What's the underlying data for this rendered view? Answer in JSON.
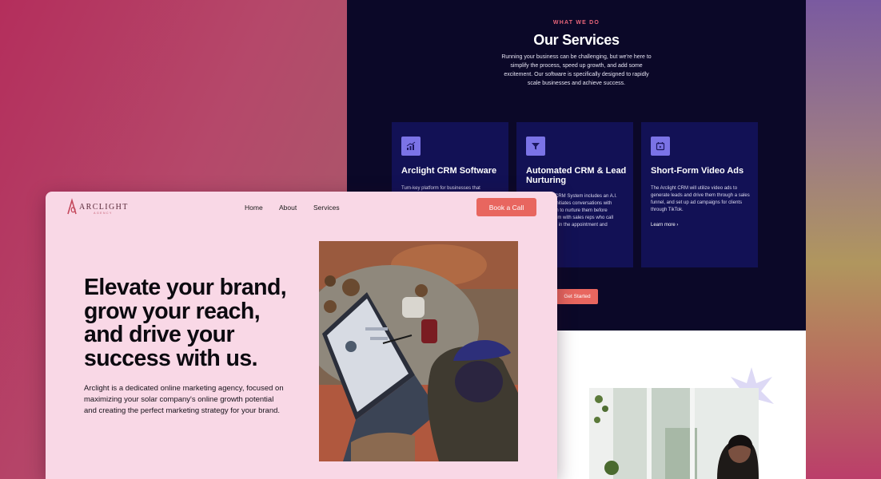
{
  "services": {
    "eyebrow": "WHAT WE DO",
    "title": "Our Services",
    "description": "Running your business can be challenging, but we're here to simplify the process, speed up growth, and add some excitement. Our software is specifically designed to rapidly scale businesses and achieve success.",
    "cards": [
      {
        "title": "Arclight CRM Software",
        "description": "Turn-key platform for businesses that",
        "icon": "chart-growth-icon"
      },
      {
        "title": "Automated CRM & Lead Nurturing",
        "description_lines": [
          "CRM System includes an A.I.",
          "initiates conversations with",
          "in to nurture them before",
          "em with sales reps who call",
          "k in the appointment and"
        ],
        "icon": "funnel-icon"
      },
      {
        "title": "Short-Form Video Ads",
        "description": "The Arclight CRM will utilize video ads to generate leads and drive them through a sales funnel, and set up ad campaigns for clients through TikTok.",
        "link": "Learn more ›",
        "icon": "video-calendar-icon"
      }
    ],
    "cta": "Get Started"
  },
  "hero": {
    "logo": {
      "name": "ARCLIGHT",
      "sub": "AGENCY"
    },
    "nav": [
      "Home",
      "About",
      "Services"
    ],
    "book_button": "Book a Call",
    "headline": "Elevate your brand, grow your reach, and drive your success with us.",
    "description": "Arclight is a dedicated online marketing agency, focused on maximizing your solar company's online growth potential and creating the perfect marketing strategy for your brand."
  },
  "colors": {
    "accent": "#e8665f",
    "dark_panel": "#0b0828",
    "card": "#121155",
    "icon_bg": "#7b73e6",
    "hero_bg": "#f9d8e6"
  }
}
